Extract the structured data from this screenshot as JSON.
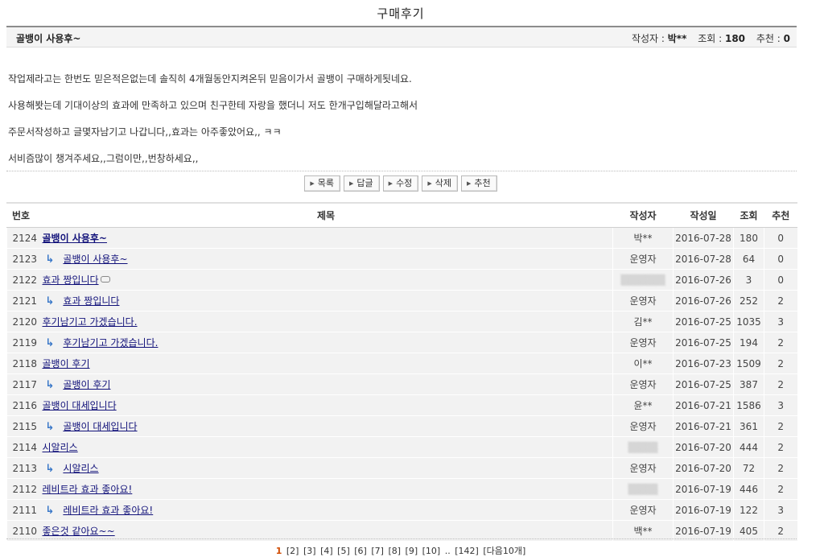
{
  "board": {
    "title": "구매후기"
  },
  "post": {
    "subject": "골뱅이 사용후~",
    "author_label": "작성자 :",
    "author": "박**",
    "views_label": "조회 :",
    "views": "180",
    "recommend_label": "추천 :",
    "recommend": "0",
    "body": [
      "작업제라고는 한번도 믿은적은없는데 솔직히 4개월동안지켜온뒤 믿음이가서 골뱅이 구매하게됫네요.",
      "사용해봣는데 기대이상의 효과에 만족하고 있으며 친구한테 자랑을 했더니 저도 한개구입해달라고해서",
      "주문서작성하고 글몇자남기고 나갑니다,,효과는 아주좋았어요,, ㅋㅋ",
      "서비즘많이 챙겨주세요,,그럼이만,,번창하세요,,"
    ]
  },
  "buttons": {
    "list": "목록",
    "reply": "답글",
    "edit": "수정",
    "delete": "삭제",
    "recommend": "추천"
  },
  "table": {
    "headers": {
      "num": "번호",
      "title": "제목",
      "author": "작성자",
      "date": "작성일",
      "views": "조회",
      "recommend": "추천"
    },
    "rows": [
      {
        "num": "2124",
        "title": "골뱅이 사용후~",
        "author": "박**",
        "date": "2016-07-28",
        "views": "180",
        "rec": "0"
      },
      {
        "num": "2123",
        "title": "골뱅이 사용후~",
        "author": "운영자",
        "date": "2016-07-28",
        "views": "64",
        "rec": "0"
      },
      {
        "num": "2122",
        "title": "효과 짱입니다",
        "author": "",
        "date": "2016-07-26",
        "views": "3",
        "rec": "0"
      },
      {
        "num": "2121",
        "title": "효과 짱입니다",
        "author": "운영자",
        "date": "2016-07-26",
        "views": "252",
        "rec": "2"
      },
      {
        "num": "2120",
        "title": "후기남기고 가겠습니다.",
        "author": "김**",
        "date": "2016-07-25",
        "views": "1035",
        "rec": "3"
      },
      {
        "num": "2119",
        "title": "후기남기고 가겠습니다.",
        "author": "운영자",
        "date": "2016-07-25",
        "views": "194",
        "rec": "2"
      },
      {
        "num": "2118",
        "title": "골뱅이 후기",
        "author": "이**",
        "date": "2016-07-23",
        "views": "1509",
        "rec": "2"
      },
      {
        "num": "2117",
        "title": "골뱅이 후기",
        "author": "운영자",
        "date": "2016-07-25",
        "views": "387",
        "rec": "2"
      },
      {
        "num": "2116",
        "title": "골뱅이 대세입니다",
        "author": "윤**",
        "date": "2016-07-21",
        "views": "1586",
        "rec": "3"
      },
      {
        "num": "2115",
        "title": "골뱅이 대세입니다",
        "author": "운영자",
        "date": "2016-07-21",
        "views": "361",
        "rec": "2"
      },
      {
        "num": "2114",
        "title": "시알리스",
        "author": "",
        "date": "2016-07-20",
        "views": "444",
        "rec": "2"
      },
      {
        "num": "2113",
        "title": "시알리스",
        "author": "운영자",
        "date": "2016-07-20",
        "views": "72",
        "rec": "2"
      },
      {
        "num": "2112",
        "title": "레비트라 효과 좋아요!",
        "author": "",
        "date": "2016-07-19",
        "views": "446",
        "rec": "2"
      },
      {
        "num": "2111",
        "title": "레비트라 효과 좋아요!",
        "author": "운영자",
        "date": "2016-07-19",
        "views": "122",
        "rec": "3"
      },
      {
        "num": "2110",
        "title": "좋은것 같아요~~",
        "author": "백**",
        "date": "2016-07-19",
        "views": "405",
        "rec": "2"
      }
    ]
  },
  "pager": {
    "current": "1",
    "pages": [
      "[2]",
      "[3]",
      "[4]",
      "[5]",
      "[6]",
      "[7]",
      "[8]",
      "[9]",
      "[10]",
      "..",
      "[142]"
    ],
    "next": "[다음10개]"
  }
}
